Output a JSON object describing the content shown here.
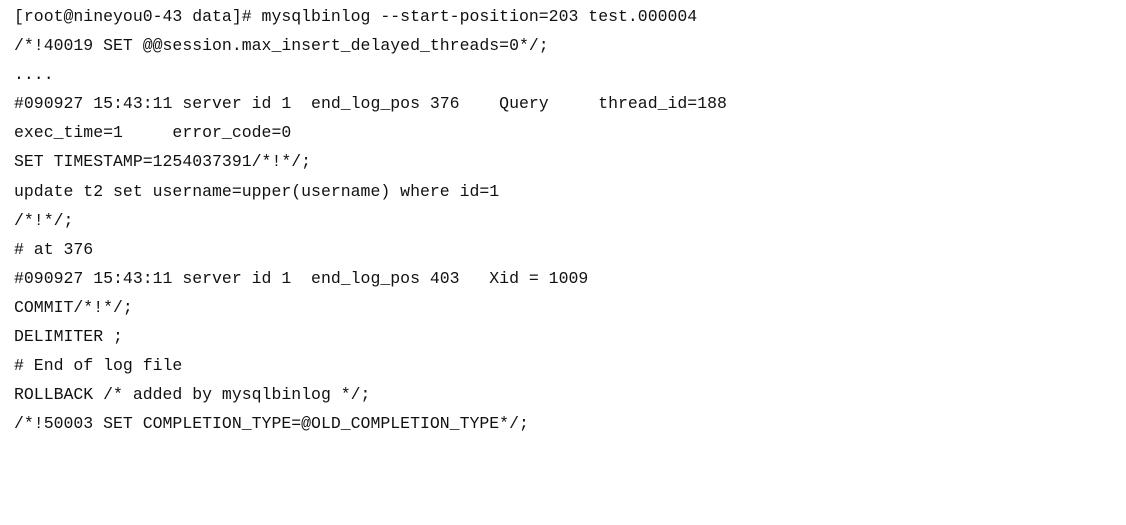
{
  "terminal": {
    "lines": [
      "[root@nineyou0-43 data]# mysqlbinlog --start-position=203 test.000004",
      "/*!40019 SET @@session.max_insert_delayed_threads=0*/;",
      "....",
      "#090927 15:43:11 server id 1  end_log_pos 376    Query     thread_id=188",
      "exec_time=1     error_code=0",
      "SET TIMESTAMP=1254037391/*!*/;",
      "update t2 set username=upper(username) where id=1",
      "/*!*/;",
      "# at 376",
      "#090927 15:43:11 server id 1  end_log_pos 403   Xid = 1009",
      "COMMIT/*!*/;",
      "DELIMITER ;",
      "# End of log file",
      "ROLLBACK /* added by mysqlbinlog */;",
      "/*!50003 SET COMPLETION_TYPE=@OLD_COMPLETION_TYPE*/;"
    ]
  }
}
